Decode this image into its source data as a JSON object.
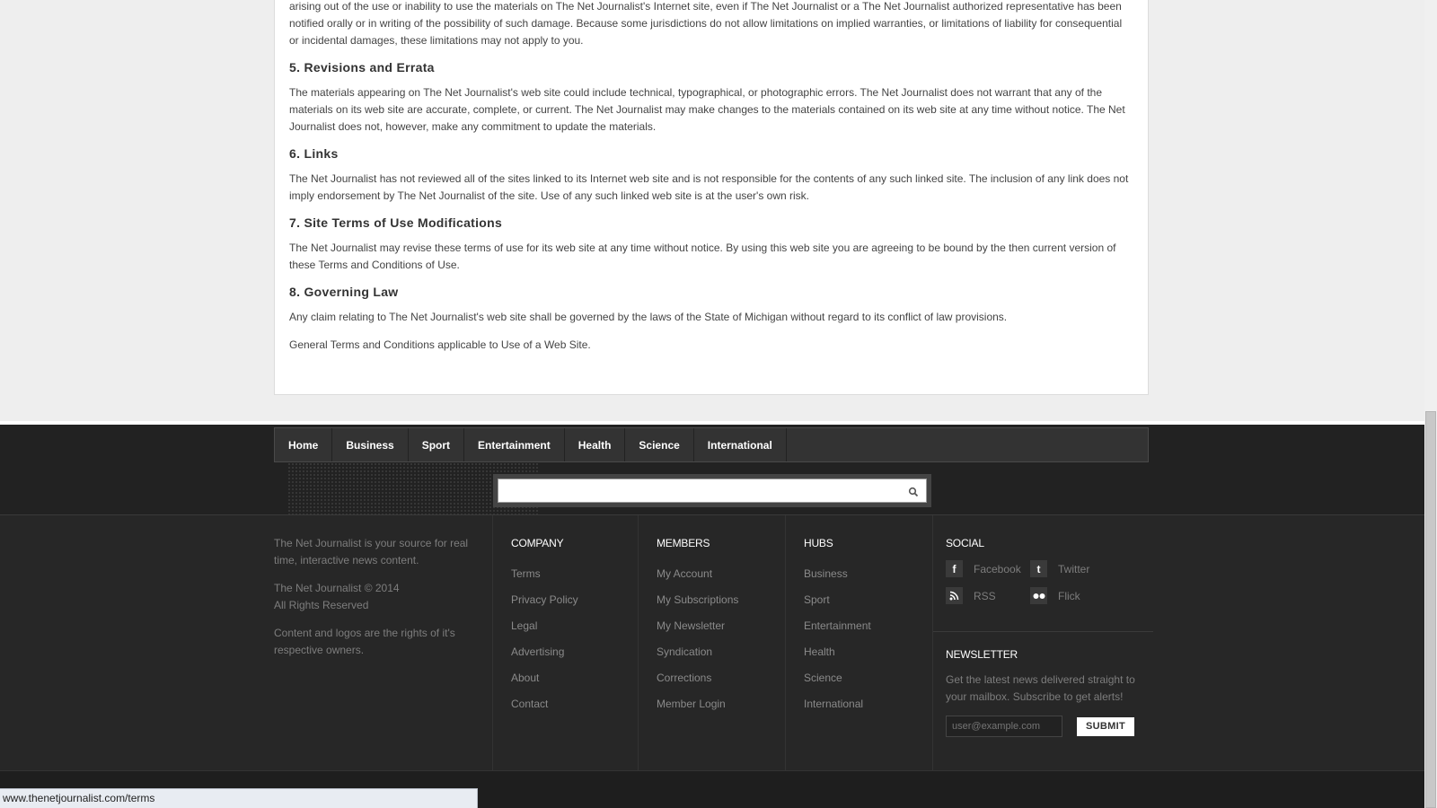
{
  "content": {
    "intro_tail": "arising out of the use or inability to use the materials on The Net Journalist's Internet site, even if The Net Journalist or a The Net Journalist authorized representative has been notified orally or in writing of the possibility of such damage. Because some jurisdictions do not allow limitations on implied warranties, or limitations of liability for consequential or incidental damages, these limitations may not apply to you.",
    "sections": [
      {
        "heading": "5. Revisions and Errata",
        "body": "The materials appearing on The Net Journalist's web site could include technical, typographical, or photographic errors. The Net Journalist does not warrant that any of the materials on its web site are accurate, complete, or current. The Net Journalist may make changes to the materials contained on its web site at any time without notice. The Net Journalist does not, however, make any commitment to update the materials."
      },
      {
        "heading": "6. Links",
        "body": "The Net Journalist has not reviewed all of the sites linked to its Internet web site and is not responsible for the contents of any such linked site. The inclusion of any link does not imply endorsement by The Net Journalist of the site. Use of any such linked web site is at the user's own risk."
      },
      {
        "heading": "7. Site Terms of Use Modifications",
        "body": "The Net Journalist may revise these terms of use for its web site at any time without notice. By using this web site you are agreeing to be bound by the then current version of these Terms and Conditions of Use."
      },
      {
        "heading": "8. Governing Law",
        "body": "Any claim relating to The Net Journalist's web site shall be governed by the laws of the State of Michigan without regard to its conflict of law provisions."
      }
    ],
    "closing": "General Terms and Conditions applicable to Use of a Web Site."
  },
  "nav": {
    "items": [
      "Home",
      "Business",
      "Sport",
      "Entertainment",
      "Health",
      "Science",
      "International"
    ]
  },
  "search": {
    "value": "",
    "icon": "search-icon"
  },
  "about": {
    "line1": "The Net Journalist is your source for real time, interactive news content.",
    "copyright": "The Net Journalist © 2014",
    "rights": "All Rights Reserved",
    "notice": "Content and logos are the rights of it's respective owners."
  },
  "company": {
    "title": "COMPANY",
    "links": [
      "Terms",
      "Privacy Policy",
      "Legal",
      "Advertising",
      "About",
      "Contact"
    ]
  },
  "members": {
    "title": "MEMBERS",
    "links": [
      "My Account",
      "My Subscriptions",
      "My Newsletter",
      "Syndication",
      "Corrections",
      "Member Login"
    ]
  },
  "hubs": {
    "title": "HUBS",
    "links": [
      "Business",
      "Sport",
      "Entertainment",
      "Health",
      "Science",
      "International"
    ]
  },
  "social": {
    "title": "SOCIAL",
    "facebook": "Facebook",
    "twitter": "Twitter",
    "rss": "RSS",
    "flickr": "Flick"
  },
  "newsletter": {
    "title": "NEWSLETTER",
    "text": "Get the latest news delivered straight to your mailbox. Subscribe to get alerts!",
    "placeholder": "user@example.com",
    "submit": "SUBMIT"
  },
  "status": {
    "url": "www.thenetjournalist.com/terms"
  },
  "colors": {
    "footer_bg": "#272727",
    "nav_bg": "#333333",
    "page_bg": "#eeeeee"
  }
}
